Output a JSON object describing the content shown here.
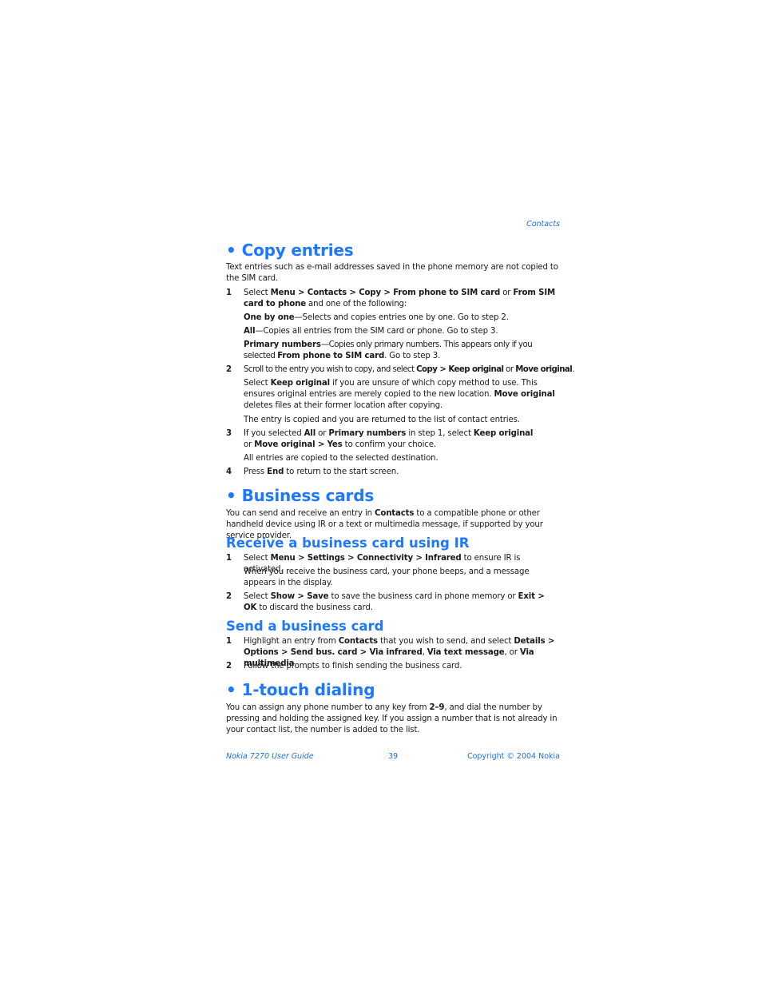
{
  "header": {
    "section": "Contacts"
  },
  "copy_entries": {
    "title": "Copy entries",
    "intro": "Text entries such as e-mail addresses saved in the phone memory are not copied to the SIM card.",
    "steps": [
      {
        "num": "1",
        "parts": [
          "Select ",
          "Menu",
          " > ",
          "Contacts",
          " > ",
          "Copy",
          " > ",
          "From phone to SIM card",
          " or ",
          "From SIM card to phone",
          " and one of the following:"
        ],
        "options": [
          {
            "term": "One by one",
            "desc": "—Selects and copies entries one by one. Go to step 2."
          },
          {
            "term": "All",
            "desc": "—Copies all entries from the SIM card or phone. Go to step 3."
          },
          {
            "term": "Primary numbers",
            "desc": "—Copies only primary numbers. This appears only if you selected ",
            "term2": "From phone to SIM card",
            "desc2": ". Go to step 3."
          }
        ]
      },
      {
        "num": "2",
        "parts": [
          "Scroll to the entry you wish to copy, and select ",
          "Copy",
          " > ",
          "Keep original",
          " or ",
          "Move original",
          "."
        ],
        "notes": [
          {
            "parts": [
              "Select ",
              "Keep original",
              " if you are unsure of which copy method to use. This ensures original entries are merely copied to the new location. ",
              "Move original",
              " deletes files at their former location after copying."
            ]
          },
          {
            "parts": [
              "The entry is copied and you are returned to the list of contact entries."
            ]
          }
        ]
      },
      {
        "num": "3",
        "parts": [
          "If you selected ",
          "All",
          " or ",
          "Primary numbers",
          " in step 1, select ",
          "Keep original",
          " or ",
          "Move original",
          " > ",
          "Yes",
          " to confirm your choice."
        ],
        "notes": [
          {
            "parts": [
              "All entries are copied to the selected destination."
            ]
          }
        ]
      },
      {
        "num": "4",
        "parts": [
          "Press ",
          "End",
          " to return to the start screen."
        ]
      }
    ]
  },
  "business_cards": {
    "title": "Business cards",
    "intro": [
      "You can send and receive an entry in ",
      "Contacts",
      " to a compatible phone or other handheld device using IR or a text or multimedia message, if supported by your service provider."
    ],
    "receive": {
      "title": "Receive a business card using IR",
      "steps": [
        {
          "num": "1",
          "parts": [
            "Select ",
            "Menu",
            " > ",
            "Settings",
            " > ",
            "Connectivity",
            " > ",
            "Infrared",
            " to ensure IR is activated."
          ],
          "note": "When you receive the business card, your phone beeps, and a message appears in the display."
        },
        {
          "num": "2",
          "parts": [
            "Select ",
            "Show",
            " > ",
            "Save",
            " to save the business card in phone memory or ",
            "Exit",
            " > ",
            "OK",
            " to discard the business card."
          ]
        }
      ]
    },
    "send": {
      "title": "Send a business card",
      "steps": [
        {
          "num": "1",
          "parts": [
            "Highlight an entry from ",
            "Contacts",
            " that you wish to send, and select ",
            "Details",
            " > ",
            "Options",
            " > ",
            "Send bus. card",
            " > ",
            "Via infrared",
            ", ",
            "Via text message",
            ", or ",
            "Via multimedia",
            "."
          ]
        },
        {
          "num": "2",
          "parts": [
            "Follow the prompts to finish sending the business card."
          ]
        }
      ]
    }
  },
  "one_touch": {
    "title": "1-touch dialing",
    "intro": [
      "You can assign any phone number to any key from ",
      "2–9",
      ", and dial the number by pressing and holding the assigned key. If you assign a number that is not already in your contact list, the number is added to the list."
    ]
  },
  "footer": {
    "guide": "Nokia 7270 User Guide",
    "page": "39",
    "copyright": "Copyright © 2004 Nokia"
  }
}
